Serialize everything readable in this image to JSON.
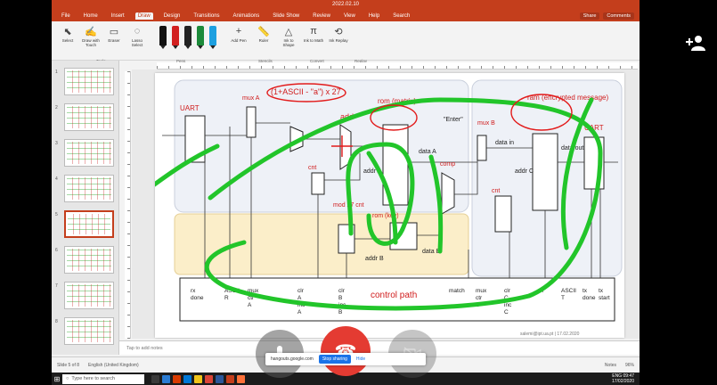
{
  "window": {
    "title": "2022.02.10"
  },
  "ribbon_tabs": [
    "File",
    "Home",
    "Insert",
    "Draw",
    "Design",
    "Transitions",
    "Animations",
    "Slide Show",
    "Review",
    "View",
    "Help",
    "Search"
  ],
  "active_tab": "Draw",
  "share": {
    "share_label": "Share",
    "comments_label": "Comments"
  },
  "draw_tools": [
    {
      "label": "Select",
      "icon": "cursor-icon"
    },
    {
      "label": "Draw with Touch",
      "icon": "touch-draw-icon"
    },
    {
      "label": "Eraser",
      "icon": "eraser-icon"
    },
    {
      "label": "Lasso Select",
      "icon": "lasso-icon"
    }
  ],
  "pens": [
    {
      "color": "#111111"
    },
    {
      "color": "#d22020"
    },
    {
      "color": "#222222"
    },
    {
      "color": "#1c8a3a"
    },
    {
      "color": "#1ea0e0"
    }
  ],
  "ribbon_buttons": [
    {
      "label": "Add Pen",
      "icon": "add-pen-icon"
    },
    {
      "label": "Ruler",
      "icon": "ruler-icon"
    },
    {
      "label": "Ink to Shape",
      "icon": "ink-shape-icon"
    },
    {
      "label": "Ink to Math",
      "icon": "ink-math-icon"
    },
    {
      "label": "Ink Replay",
      "icon": "replay-icon"
    }
  ],
  "group_labels": [
    "Tools",
    "Pens",
    "Stencils",
    "Convert",
    "Replay"
  ],
  "slides": [
    "1",
    "2",
    "3",
    "4",
    "5",
    "6",
    "7",
    "8"
  ],
  "selected_slide": 5,
  "notes_placeholder": "Tap to add notes",
  "status": {
    "slide_info": "Slide 5 of 8",
    "language": "English (United Kingdom)",
    "notes_label": "Notes",
    "zoom": "96%"
  },
  "call": {
    "share_url": "hangouts.google.com",
    "stop_sharing": "Stop sharing",
    "hide": "Hide"
  },
  "taskbar": {
    "search_placeholder": "Type here to search",
    "time": "09:47",
    "date": "17/02/2020",
    "lang": "ENG"
  },
  "slide_text": {
    "top_formula": "(1+ASCII - \"a\") x 27",
    "uart_in": "UART",
    "uart_out": "UART",
    "mux_a": "mux A",
    "add": "add",
    "rom_matrix": "rom (matrix)",
    "ram": "ram (encrypted message)",
    "enter": "\"Enter\"",
    "mux_b": "mux B",
    "cnt_a": "cnt",
    "cnt_b": "cnt",
    "mod_cnt": "mod 27 cnt",
    "rom_key": "rom (key)",
    "comp": "comp",
    "data_a": "data A",
    "data_b": "data B",
    "data_in": "data in",
    "data_out": "data out",
    "addr_a": "addr A",
    "addr_b": "addr B",
    "addr_c": "addr C",
    "control_path": "control path",
    "bottom_labels": [
      "rx done",
      "ASCII R",
      "mux ctr A",
      "clr A inc A",
      "clr B inc B",
      "match",
      "mux ctr B",
      "clr C inc C",
      "wr",
      "ASCII T",
      "tx done",
      "tx start"
    ],
    "footer": "salemi@ipt.ua.pt | 17.02.2020"
  }
}
